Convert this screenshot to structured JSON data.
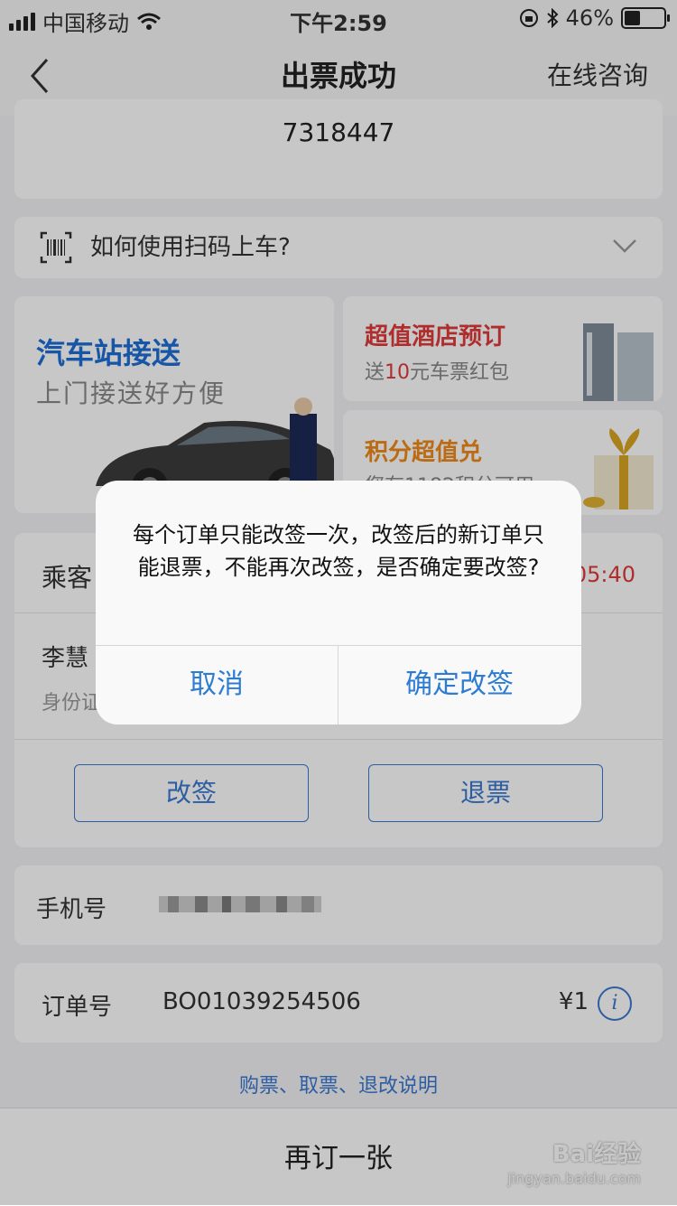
{
  "status_bar": {
    "carrier": "中国移动",
    "time": "下午2:59",
    "battery": "46%",
    "battery_level": 0.46
  },
  "nav": {
    "title": "出票成功",
    "right_label": "在线咨询"
  },
  "ticket": {
    "code": "7318447"
  },
  "scan_help": {
    "label": "如何使用扫码上车?"
  },
  "promos": {
    "shuttle": {
      "title": "汽车站接送",
      "subtitle": "上门接送好方便"
    },
    "hotel": {
      "title": "超值酒店预订",
      "subtitle_pre": "送",
      "subtitle_num": "10",
      "subtitle_post": "元车票红包"
    },
    "points": {
      "title": "积分超值兑",
      "subtitle": "您有1182积分可用"
    }
  },
  "passenger": {
    "title": "乘客",
    "time": "05:40",
    "name": "李慧",
    "id_label": "身份证",
    "change_button": "改签",
    "refund_button": "退票"
  },
  "phone": {
    "label": "手机号"
  },
  "order": {
    "label": "订单号",
    "number": "BO01039254506",
    "price": "¥1",
    "info_icon": "i"
  },
  "help_link": "购票、取票、退改说明",
  "bottom": {
    "rebook": "再订一张"
  },
  "watermark": {
    "brand": "Bai经验",
    "url": "jingyan.baidu.com"
  },
  "dialog": {
    "message": "每个订单只能改签一次，改签后的新订单只能退票，不能再次改签，是否确定要改签?",
    "cancel": "取消",
    "confirm": "确定改签"
  }
}
